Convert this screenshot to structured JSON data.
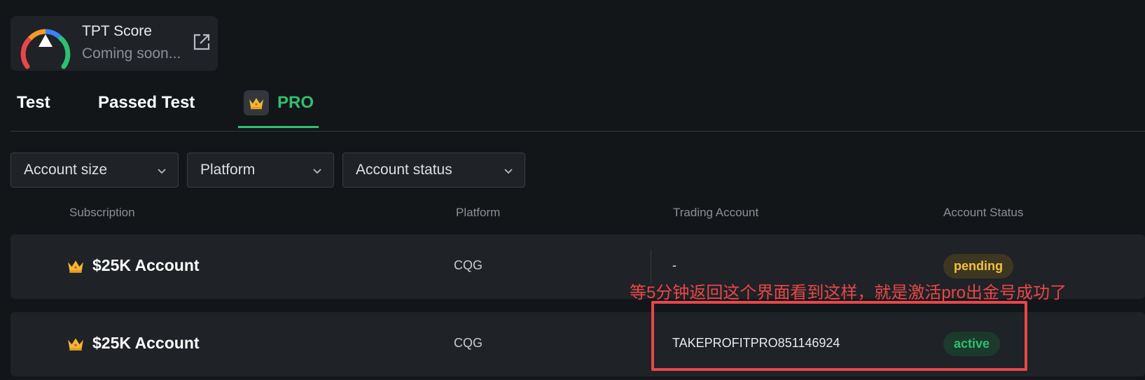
{
  "score_card": {
    "title": "TPT Score",
    "subtitle": "Coming soon...",
    "gauge_icon": "gauge-icon",
    "link_icon": "external-link-icon"
  },
  "tabs": [
    {
      "label": "Test",
      "active": false
    },
    {
      "label": "Passed Test",
      "active": false
    },
    {
      "label": "PRO",
      "active": true,
      "icon": "crown-icon"
    }
  ],
  "filters": [
    {
      "label": "Account size"
    },
    {
      "label": "Platform"
    },
    {
      "label": "Account status"
    }
  ],
  "table": {
    "headers": [
      "Subscription",
      "Platform",
      "Trading Account",
      "Account Status"
    ],
    "rows": [
      {
        "name": "$25K Account",
        "platform": "CQG",
        "account": "-",
        "status": "pending"
      },
      {
        "name": "$25K Account",
        "platform": "CQG",
        "account": "TAKEPROFITPRO851146924",
        "status": "active"
      }
    ]
  },
  "annotation": {
    "text": "等5分钟返回这个界面看到这样，就是激活pro出金号成功了"
  },
  "colors": {
    "background": "#131619",
    "card": "#1f2226",
    "accent_green": "#2fbf71",
    "pending_yellow": "#f2c23a",
    "annotation_red": "#e8474a"
  }
}
